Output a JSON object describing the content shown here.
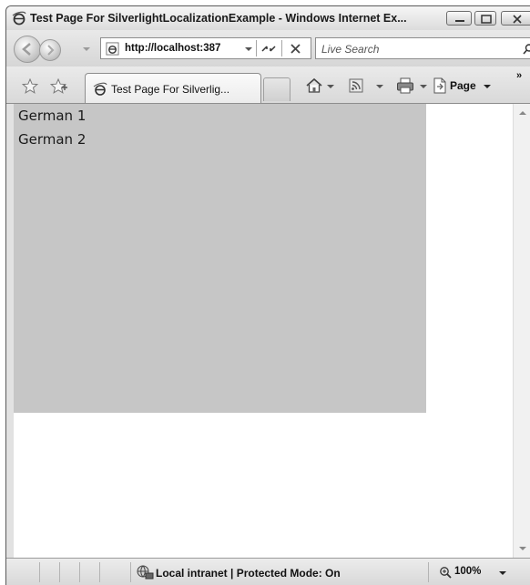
{
  "window": {
    "title": "Test Page For SilverlightLocalizationExample - Windows Internet Ex..."
  },
  "address_bar": {
    "url": "http://localhost:387"
  },
  "search": {
    "placeholder": "Live Search"
  },
  "tabs": [
    {
      "label": "Test Page For Silverlig..."
    }
  ],
  "command_bar": {
    "page_label": "Page",
    "chevron": "»"
  },
  "content": {
    "lines": [
      "German 1",
      "German 2"
    ],
    "background_color": "#c6c6c6"
  },
  "status_bar": {
    "zone": "Local intranet | Protected Mode: On",
    "zoom": "100%"
  }
}
